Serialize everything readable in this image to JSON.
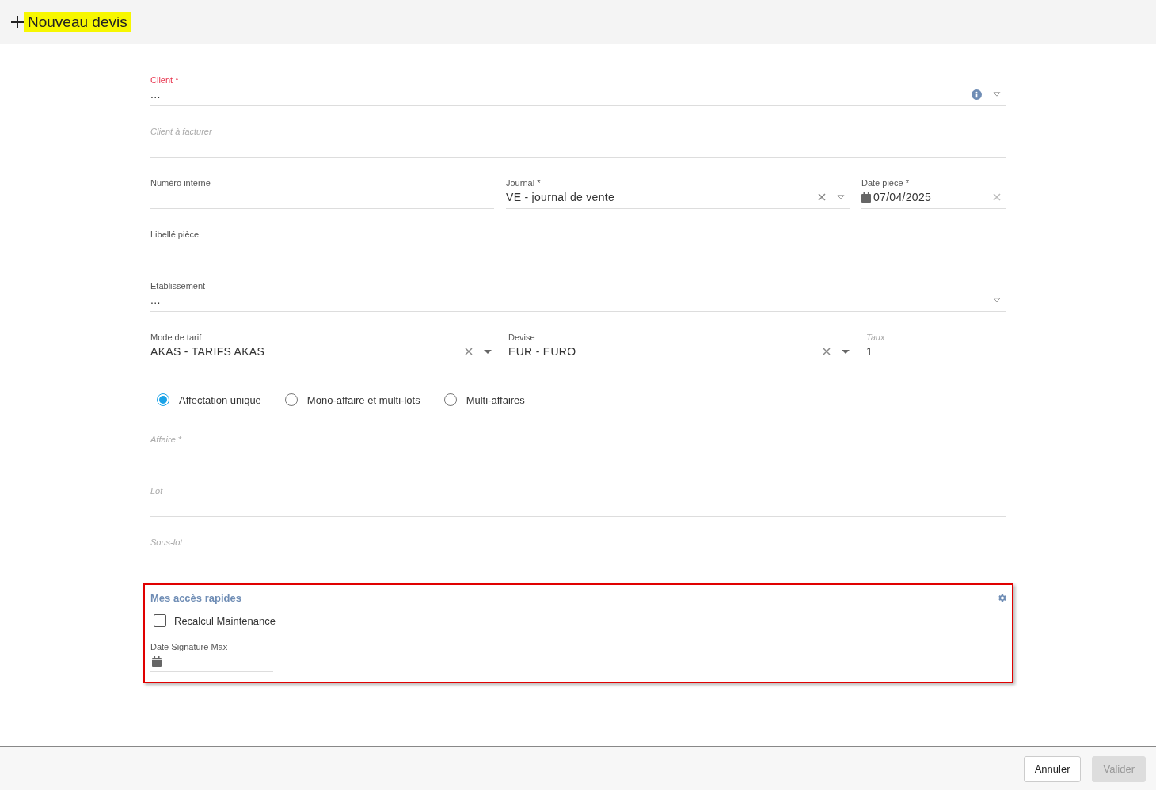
{
  "header": {
    "title": "Nouveau devis",
    "highlighted": true
  },
  "form": {
    "rows": [
      {
        "fields": [
          {
            "label": "Client *",
            "value": "...",
            "kind": "lookup",
            "invalid": true,
            "disabled": false
          }
        ]
      },
      {
        "fields": [
          {
            "label": "Client à facturer",
            "invalid": false,
            "disabled": true
          }
        ]
      },
      {
        "fields": [
          {
            "label": "Numéro interne",
            "invalid": false,
            "disabled": false
          },
          {
            "label": "Journal *",
            "value": "VE - journal de vente",
            "kind": "combo",
            "invalid": false,
            "disabled": false
          },
          {
            "label": "Date pièce *",
            "value": "07/04/2025",
            "kind": "date",
            "invalid": false,
            "disabled": false
          }
        ]
      },
      {
        "fields": [
          {
            "label": "Libellé pièce",
            "invalid": false,
            "disabled": false
          }
        ]
      },
      {
        "fields": [
          {
            "label": "Etablissement",
            "value": "...",
            "kind": "picker",
            "invalid": false,
            "disabled": false
          }
        ]
      },
      {
        "fields": [
          {
            "label": "Mode de tarif",
            "value": "AKAS - TARIFS AKAS",
            "kind": "select",
            "invalid": false,
            "disabled": false
          },
          {
            "label": "Devise",
            "value": "EUR - EURO",
            "kind": "select",
            "invalid": false,
            "disabled": false
          },
          {
            "label": "Taux",
            "value": "1",
            "invalid": false,
            "disabled": true
          }
        ]
      }
    ],
    "assignment": [
      {
        "label": "Affectation unique",
        "selected": true
      },
      {
        "label": "Mono-affaire et multi-lots",
        "selected": false
      },
      {
        "label": "Multi-affaires",
        "selected": false
      }
    ],
    "rows2": [
      {
        "fields": [
          {
            "label": "Affaire *",
            "invalid": false,
            "disabled": true
          }
        ]
      },
      {
        "fields": [
          {
            "label": "Lot",
            "invalid": false,
            "disabled": true
          }
        ]
      },
      {
        "fields": [
          {
            "label": "Sous-lot",
            "invalid": false,
            "disabled": true
          }
        ]
      }
    ]
  },
  "quick_access": {
    "title": "Mes accès rapides",
    "checkbox": {
      "label": "Recalcul Maintenance",
      "checked": false
    },
    "date_field": {
      "label": "Date Signature Max"
    }
  },
  "footer": {
    "buttons": [
      {
        "label": "Annuler",
        "disabled": false
      },
      {
        "label": "Valider",
        "disabled": true
      }
    ]
  }
}
